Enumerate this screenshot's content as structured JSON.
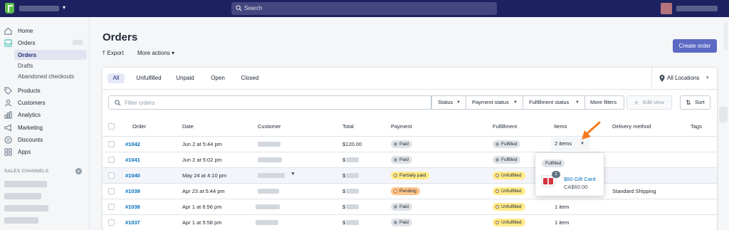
{
  "topbar": {
    "search_placeholder": "Search"
  },
  "sidebar": {
    "items": [
      {
        "label": "Home"
      },
      {
        "label": "Orders"
      },
      {
        "label": "Products"
      },
      {
        "label": "Customers"
      },
      {
        "label": "Analytics"
      },
      {
        "label": "Marketing"
      },
      {
        "label": "Discounts"
      },
      {
        "label": "Apps"
      }
    ],
    "orders_sub": [
      {
        "label": "Orders"
      },
      {
        "label": "Drafts"
      },
      {
        "label": "Abandoned checkouts"
      }
    ],
    "sales_channels_label": "SALES CHANNELS"
  },
  "page": {
    "title": "Orders",
    "export_label": "Export",
    "more_actions_label": "More actions",
    "create_order_label": "Create order"
  },
  "tabs": [
    {
      "label": "All"
    },
    {
      "label": "Unfulfilled"
    },
    {
      "label": "Unpaid"
    },
    {
      "label": "Open"
    },
    {
      "label": "Closed"
    }
  ],
  "locations_label": "All Locations",
  "filter": {
    "placeholder": "Filter orders",
    "status_label": "Status",
    "payment_status_label": "Payment status",
    "fulfillment_status_label": "Fulfillment status",
    "more_filters_label": "More filters",
    "edit_view_label": "Edit view",
    "sort_label": "Sort"
  },
  "table": {
    "headers": {
      "order": "Order",
      "date": "Date",
      "customer": "Customer",
      "total": "Total",
      "payment": "Payment",
      "fulfillment": "Fulfillment",
      "items": "Items",
      "delivery": "Delivery method",
      "tags": "Tags"
    },
    "rows": [
      {
        "order": "#1042",
        "date": "Jun 2 at 5:44 pm",
        "total": "$120.00",
        "payment": "Paid",
        "fulfillment": "Fulfilled",
        "items": "2 items",
        "delivery": ""
      },
      {
        "order": "#1041",
        "date": "Jun 2 at 5:02 pm",
        "total": "$",
        "payment": "Paid",
        "fulfillment": "Fulfilled",
        "items": "",
        "delivery": ""
      },
      {
        "order": "#1040",
        "date": "May 24 at 4:10 pm",
        "total": "$",
        "payment": "Partially paid",
        "fulfillment": "Unfulfilled",
        "items": "",
        "delivery": ""
      },
      {
        "order": "#1039",
        "date": "Apr 23 at 5:44 pm",
        "total": "$",
        "payment": "Pending",
        "fulfillment": "Unfulfilled",
        "items": "",
        "delivery": "Standard Shipping"
      },
      {
        "order": "#1038",
        "date": "Apr 1 at 6:56 pm",
        "total": "$",
        "payment": "Paid",
        "fulfillment": "Unfulfilled",
        "items": "1 item",
        "delivery": ""
      },
      {
        "order": "#1037",
        "date": "Apr 1 at 5:58 pm",
        "total": "$",
        "payment": "Paid",
        "fulfillment": "Unfulfilled",
        "items": "1 item",
        "delivery": ""
      }
    ]
  },
  "popover": {
    "status": "Fulfilled",
    "quantity": "2",
    "product_name": "$60 Gift Card",
    "product_price": "CA$60.00"
  },
  "colors": {
    "topbar": "#1c2260",
    "primary_button": "#5c6ac4",
    "link": "#006fbb",
    "annotation_arrow": "#f47c20"
  }
}
